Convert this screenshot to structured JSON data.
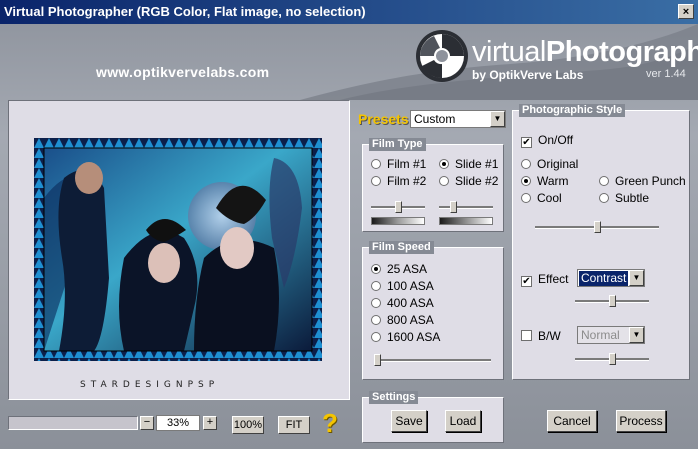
{
  "window": {
    "title": "Virtual Photographer (RGB Color, Flat image, no selection)",
    "close_glyph": "×"
  },
  "header": {
    "website": "www.optikvervelabs.com",
    "brand_virtual": "virtual",
    "brand_photographer": "Photographer",
    "byline": "by OptikVerve Labs",
    "version": "ver 1.44"
  },
  "preview": {
    "watermark": "STARDESIGNPSP"
  },
  "zoom": {
    "minus": "−",
    "value": "33%",
    "plus": "+",
    "hundred_label": "100%",
    "fit_label": "FIT",
    "help_glyph": "?"
  },
  "presets": {
    "label": "Presets",
    "value": "Custom"
  },
  "film_type": {
    "title": "Film Type",
    "options": [
      {
        "label": "Film #1",
        "selected": false
      },
      {
        "label": "Slide #1",
        "selected": true
      },
      {
        "label": "Film #2",
        "selected": false
      },
      {
        "label": "Slide #2",
        "selected": false
      }
    ],
    "slider1_level": 0.5,
    "slider2_level": 0.25
  },
  "film_speed": {
    "title": "Film Speed",
    "options": [
      {
        "label": "25 ASA",
        "selected": true
      },
      {
        "label": "100 ASA",
        "selected": false
      },
      {
        "label": "400 ASA",
        "selected": false
      },
      {
        "label": "800 ASA",
        "selected": false
      },
      {
        "label": "1600 ASA",
        "selected": false
      }
    ],
    "slider_level": 0.02
  },
  "settings": {
    "title": "Settings",
    "save_label": "Save",
    "load_label": "Load"
  },
  "photographic_style": {
    "title": "Photographic Style",
    "onoff_label": "On/Off",
    "onoff_checked": true,
    "styles": [
      {
        "label": "Original",
        "selected": false
      },
      {
        "label": "Warm",
        "selected": true
      },
      {
        "label": "Green Punch",
        "selected": false
      },
      {
        "label": "Cool",
        "selected": false
      },
      {
        "label": "Subtle",
        "selected": false
      }
    ],
    "style_slider_level": 0.5,
    "effect_label": "Effect",
    "effect_checked": true,
    "effect_value": "Contrast",
    "effect_slider_level": 0.5,
    "bw_label": "B/W",
    "bw_checked": false,
    "bw_value": "Normal",
    "bw_slider_level": 0.5
  },
  "actions": {
    "cancel_label": "Cancel",
    "process_label": "Process"
  },
  "check_glyph": "✔",
  "arrow_glyph": "▼",
  "colors": {
    "title_bar": "#0a246a",
    "panel": "#dfdde6",
    "accent_yellow": "#f4c400"
  }
}
